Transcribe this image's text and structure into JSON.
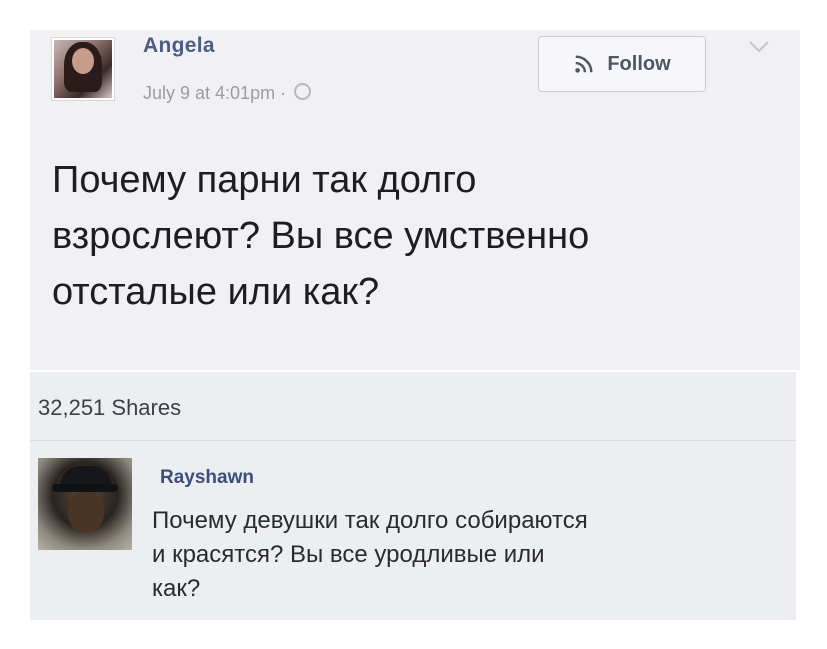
{
  "post": {
    "author": "Angela",
    "timestamp": "July 9 at 4:01pm ·",
    "follow_label": "Follow",
    "text": "Почему парни так долго\nвзрослеют? Вы все умственно\nотсталые или как?",
    "shares": "32,251 Shares"
  },
  "comment": {
    "author": "Rayshawn",
    "text": "Почему девушки так долго собираются\nи красятся? Вы все уродливые или\nкак?"
  },
  "colors": {
    "author_link": "#4c5c84",
    "post_background": "#f1f1f3",
    "comment_background": "#eceef2"
  },
  "icons": [
    "rss-icon",
    "chevron-down-icon",
    "globe-icon"
  ]
}
